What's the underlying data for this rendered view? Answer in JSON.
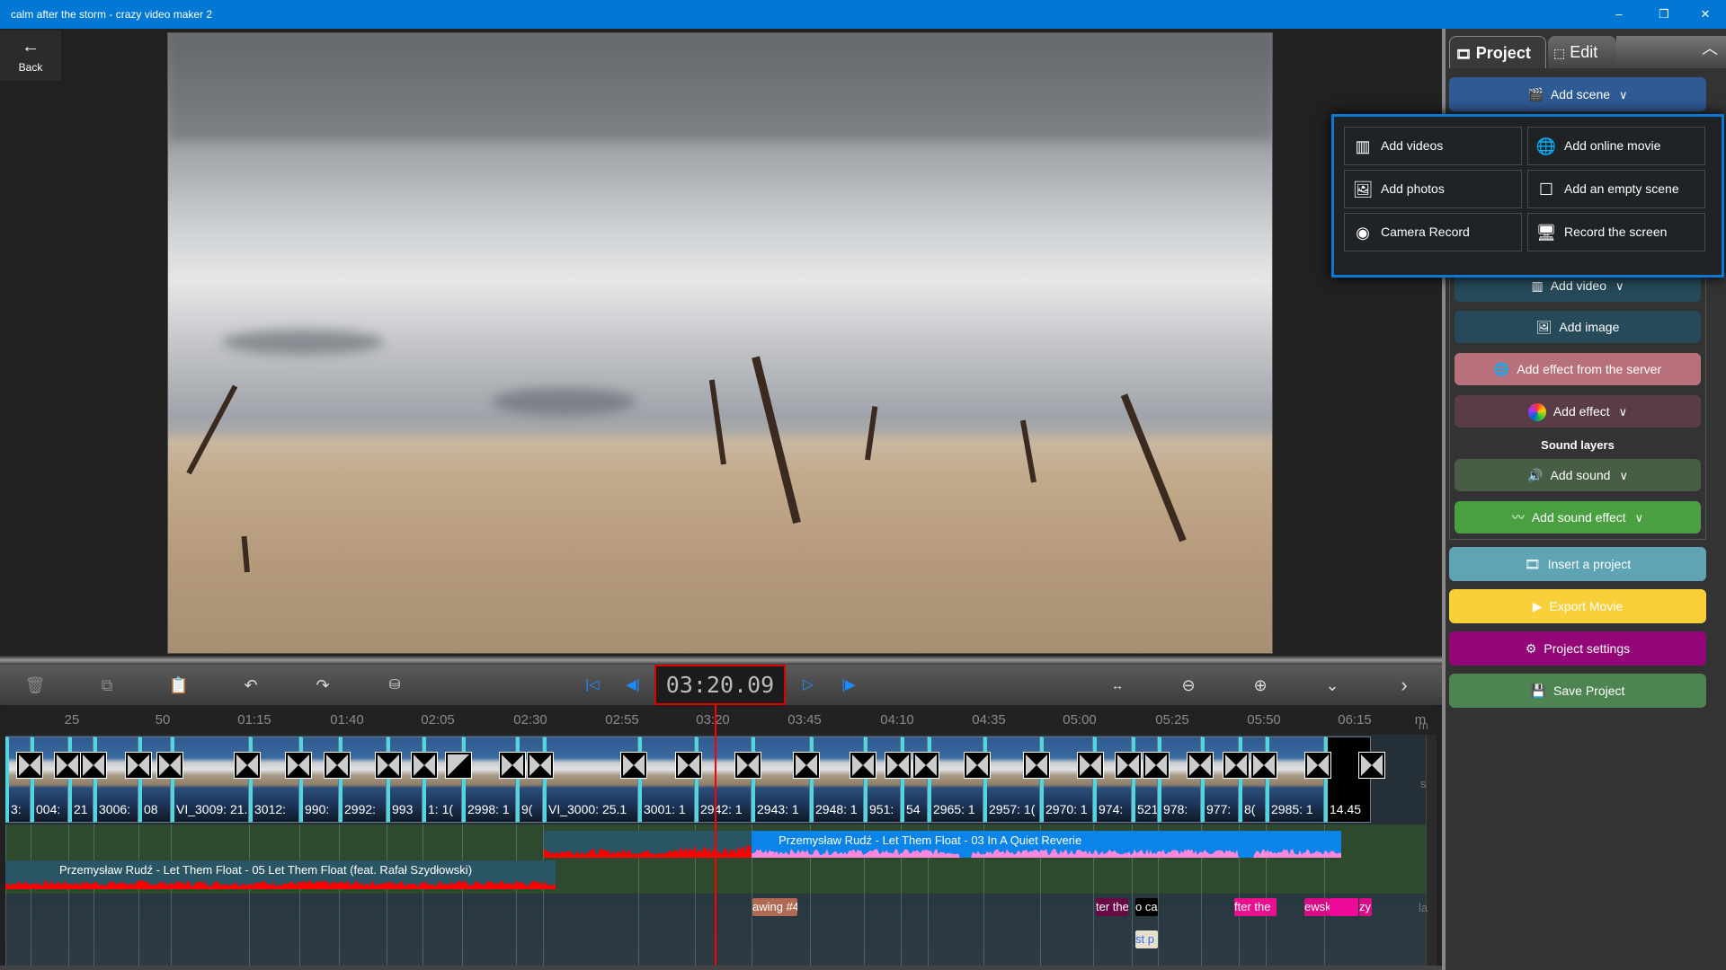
{
  "window": {
    "title": "calm after the storm - crazy video maker 2",
    "minimize": "–",
    "maximize": "❐",
    "close": "✕"
  },
  "back": {
    "label": "Back",
    "icon": "arrow-left-icon"
  },
  "toolbar": {
    "timecode": "03:20.09"
  },
  "timeline": {
    "ruler": [
      "25",
      "50",
      "01:15",
      "01:40",
      "02:05",
      "02:30",
      "02:55",
      "03:20",
      "03:45",
      "04:10",
      "04:35",
      "05:00",
      "05:25",
      "05:50",
      "06:15",
      "m"
    ],
    "clips": [
      "3: ",
      "004:",
      "21",
      "3006:",
      "08",
      "VI_3009: 21.",
      "3012: ",
      "990:",
      "2992: ",
      "993",
      "1: 1(",
      "2998: 1",
      "9(",
      "VI_3000: 25.1",
      "3001: 1",
      "2942: 1",
      "2943: 1",
      "2948: 1",
      "951:",
      "54",
      "2965: 1",
      "2957: 1(",
      "2970: 1",
      "974:",
      "521",
      "978:",
      "977:",
      "8(",
      "2985: 1",
      "14.45"
    ],
    "audio": [
      {
        "title": "Przemysław Rudź - Let Them Float - 05 Let Them Float (feat. Rafał Szydłowski)",
        "color": "#2a5565",
        "wave": "#ff0000"
      },
      {
        "title": "",
        "color": "#2a5565",
        "wave": "#ff0000"
      },
      {
        "title": "Przemysław Rudź - Let Them Float - 03 In A Quiet Reverie",
        "color": "#0a84e8",
        "wave": "#ff88dd"
      }
    ],
    "texts": [
      {
        "label": "awing #4",
        "color": "#b06a52",
        "fg": "#fff"
      },
      {
        "label": "ter the",
        "color": "#6a0a44",
        "fg": "#fff"
      },
      {
        "label": "o ca",
        "color": "#000000",
        "fg": "#fff"
      },
      {
        "label": "st p",
        "color": "#e6e0cc",
        "fg": "#3a6aff"
      },
      {
        "label": "fter the",
        "color": "#e8108e",
        "fg": "#fff"
      },
      {
        "label": "ewsk",
        "color": "#d80c86",
        "fg": "#fff"
      },
      {
        "label": "",
        "color": "#ee0a98",
        "fg": "#fff"
      },
      {
        "label": "zy",
        "color": "#d80c86",
        "fg": "#fff"
      }
    ],
    "side_labels": {
      "top": "m",
      "mid": "s",
      "low": "la"
    }
  },
  "panel": {
    "tabs": [
      {
        "label": "Project",
        "active": true
      },
      {
        "label": "Edit",
        "active": false
      }
    ],
    "add_scene": "Add scene",
    "popup": [
      {
        "label": "Add videos",
        "icon": "film-icon"
      },
      {
        "label": "Add online movie",
        "icon": "globe-icon"
      },
      {
        "label": "Add photos",
        "icon": "image-icon"
      },
      {
        "label": "Add an empty scene",
        "icon": "empty-square-icon"
      },
      {
        "label": "Camera Record",
        "icon": "webcam-icon"
      },
      {
        "label": "Record the screen",
        "icon": "monitor-icon"
      }
    ],
    "buttons": {
      "add_video": "Add video",
      "add_image": "Add image",
      "add_effect_server": "Add effect from the server",
      "add_effect": "Add effect",
      "sound_layers": "Sound layers",
      "add_sound": "Add sound",
      "add_sound_effect": "Add sound effect",
      "insert_project": "Insert a project",
      "export_movie": "Export Movie",
      "project_settings": "Project settings",
      "save_project": "Save Project"
    },
    "colors": {
      "add_scene": "#2f5a94",
      "add_video": "#264a5a",
      "add_effect_server": "#b8707a",
      "add_effect": "#5a3c44",
      "add_sound": "#485e44",
      "add_sound_effect": "#4aa040",
      "insert_project": "#5ea4b4",
      "export_movie": "#f9cf3a",
      "project_settings": "#940578",
      "save_project": "#4e8452"
    }
  }
}
